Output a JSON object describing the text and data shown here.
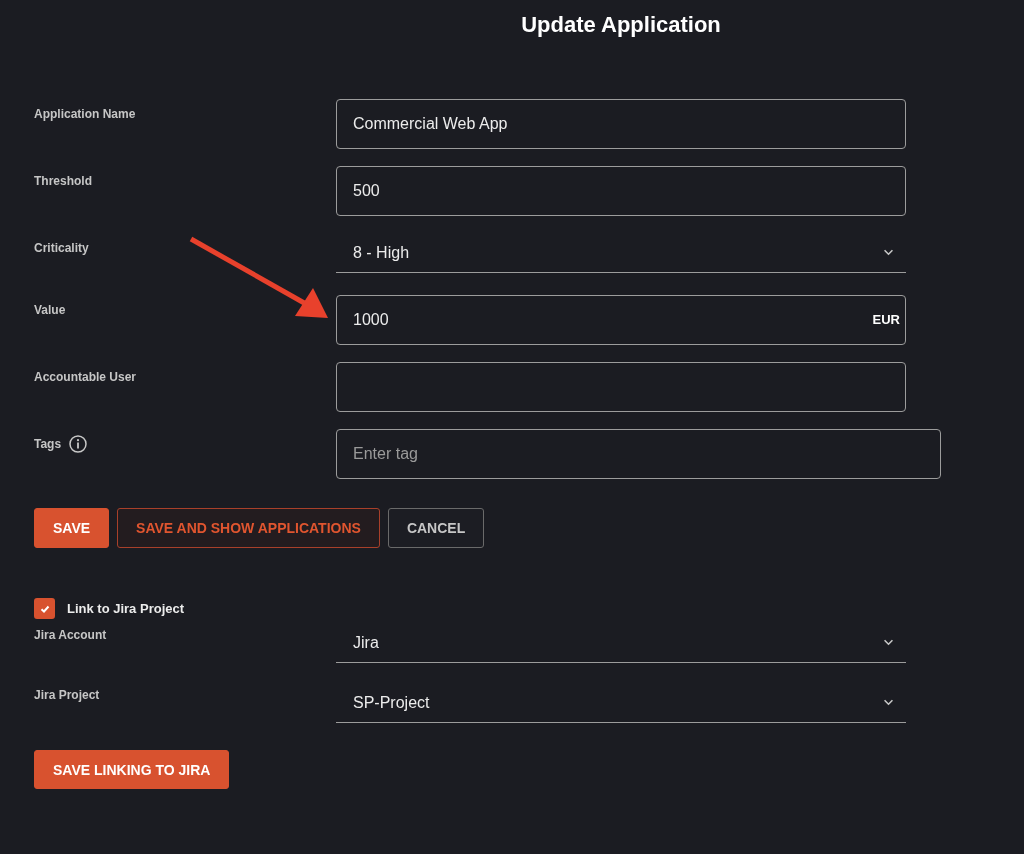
{
  "title": "Update Application",
  "fields": [
    {
      "kind": "text",
      "label": "Application Name",
      "value": "Commercial Web App"
    },
    {
      "kind": "text",
      "label": "Threshold",
      "value": "500"
    },
    {
      "kind": "select",
      "label": "Criticality",
      "value": "8 - High"
    },
    {
      "kind": "currency",
      "label": "Value",
      "value": "1000",
      "suffix": "EUR"
    },
    {
      "kind": "text",
      "label": "Accountable User"
    },
    {
      "kind": "tags",
      "label": "Tags",
      "placeholder": "Enter tag",
      "info": true
    }
  ],
  "buttons": [
    {
      "kind": "primary",
      "label": "SAVE"
    },
    {
      "kind": "outlined",
      "label": "SAVE AND SHOW APPLICATIONS"
    },
    {
      "kind": "secondary",
      "label": "CANCEL"
    }
  ],
  "jira": {
    "checkbox": {
      "label": "Link to Jira Project",
      "checked": true
    },
    "fields": [
      {
        "kind": "select",
        "label": "Jira Account",
        "value": "Jira"
      },
      {
        "kind": "select",
        "label": "Jira Project",
        "value": "SP-Project"
      }
    ],
    "button": {
      "kind": "primary",
      "label": "SAVE LINKING TO JIRA"
    }
  }
}
